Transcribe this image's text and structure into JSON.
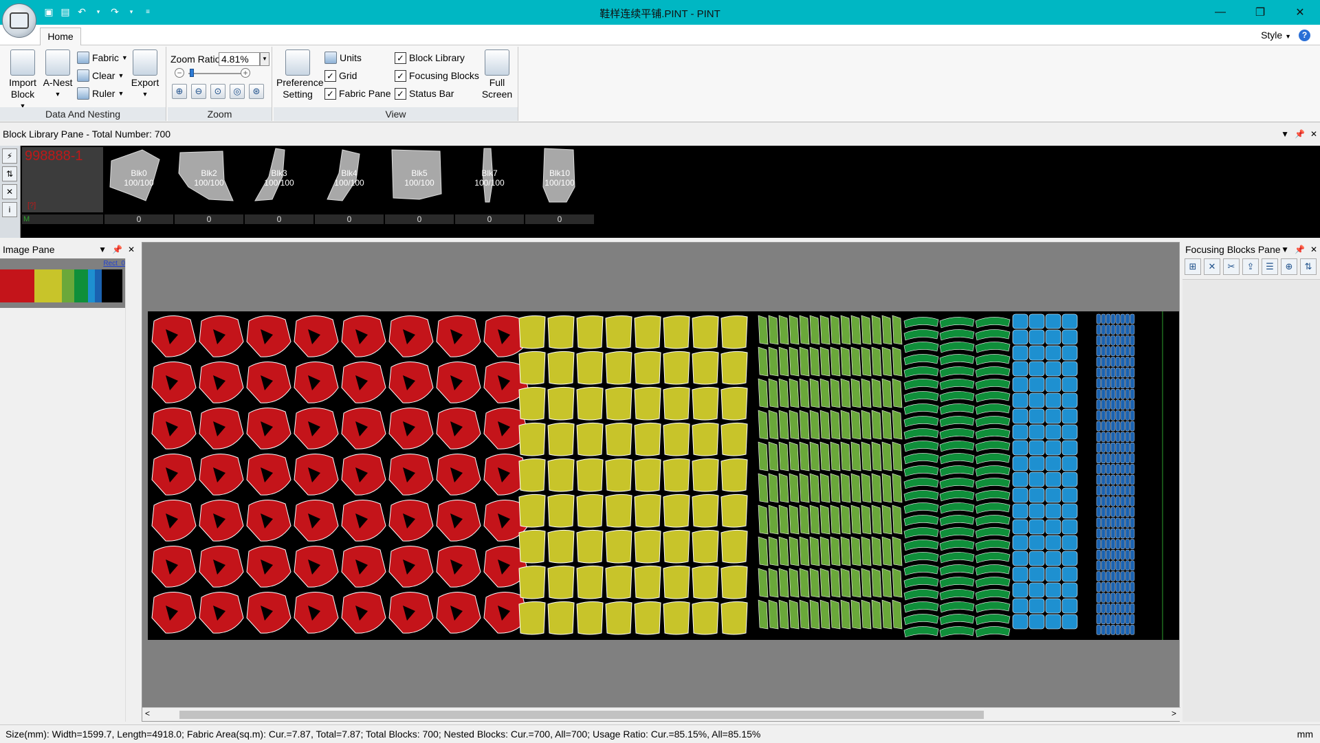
{
  "window": {
    "title": "鞋样连续平铺.PINT - PINT",
    "min": "—",
    "max": "❐",
    "close": "✕"
  },
  "tabs": {
    "home": "Home",
    "style": "Style"
  },
  "ribbon": {
    "data_nesting": {
      "label": "Data And Nesting",
      "import_block": "Import Block",
      "a_nest": "A-Nest",
      "fabric": "Fabric",
      "clear": "Clear",
      "ruler": "Ruler",
      "export": "Export"
    },
    "zoom": {
      "label": "Zoom",
      "ratio_label": "Zoom Ratio",
      "ratio_value": "4.81%",
      "slider_fraction": 0.04
    },
    "view": {
      "label": "View",
      "preference": "Preference Setting",
      "units": "Units",
      "grid": "Grid",
      "fabric_pane": "Fabric Pane",
      "block_library": "Block Library",
      "focusing_blocks": "Focusing Blocks",
      "status_bar": "Status Bar",
      "full_screen": "Full Screen",
      "checks": {
        "units": false,
        "grid": true,
        "fabric_pane": true,
        "block_library": true,
        "focusing_blocks": true,
        "status_bar": true
      }
    }
  },
  "block_library": {
    "title": "Block Library Pane - Total Number: 700",
    "first": {
      "code": "998888-1",
      "qty": "[?]",
      "mark": "M"
    },
    "blocks": [
      {
        "name": "Blk0",
        "ratio": "100/100",
        "count": "0"
      },
      {
        "name": "Blk2",
        "ratio": "100/100",
        "count": "0"
      },
      {
        "name": "Blk3",
        "ratio": "100/100",
        "count": "0"
      },
      {
        "name": "Blk4",
        "ratio": "100/100",
        "count": "0"
      },
      {
        "name": "Blk5",
        "ratio": "100/100",
        "count": "0"
      },
      {
        "name": "Blk7",
        "ratio": "100/100",
        "count": "0"
      },
      {
        "name": "Blk10",
        "ratio": "100/100",
        "count": "0"
      }
    ]
  },
  "image_pane": {
    "title": "Image Pane",
    "rect_label": "Rect_0"
  },
  "focus_pane": {
    "title": "Focusing Blocks Pane"
  },
  "colors": {
    "red": "#c4141a",
    "yellow": "#c8c42a",
    "lightgreen": "#6aa83a",
    "green": "#0f8f3a",
    "skyblue": "#1e90d0",
    "blue": "#1a62b0",
    "titlebar": "#00b7c3"
  },
  "status": {
    "text": "Size(mm): Width=1599.7, Length=4918.0; Fabric Area(sq.m): Cur.=7.87, Total=7.87; Total Blocks: 700; Nested Blocks: Cur.=700, All=700; Usage Ratio: Cur.=85.15%, All=85.15%",
    "unit": "mm"
  }
}
